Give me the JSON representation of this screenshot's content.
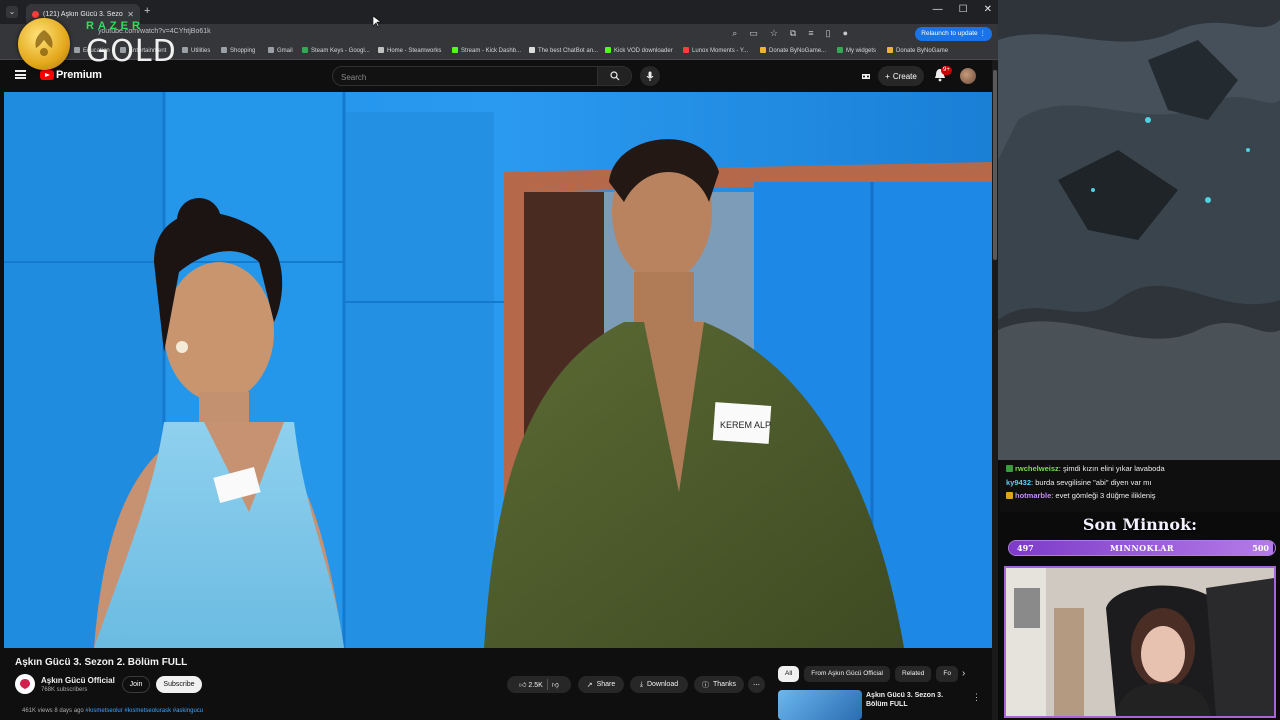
{
  "browser": {
    "tab_title": "(121) Aşkın Gücü 3. Sezon",
    "url": "youtube.com/watch?v=4CYhtjBo61k",
    "relaunch_label": "Relaunch to update",
    "bookmarks": [
      {
        "label": "Education",
        "color": "#9aa0a6"
      },
      {
        "label": "Entertainment",
        "color": "#9aa0a6"
      },
      {
        "label": "Utilities",
        "color": "#9aa0a6"
      },
      {
        "label": "Shopping",
        "color": "#9aa0a6"
      },
      {
        "label": "Gmail",
        "color": "#9aa0a6"
      },
      {
        "label": "Steam Keys - Googl...",
        "color": "#34a853"
      },
      {
        "label": "Home - Steamworks",
        "color": "#c0c0c0"
      },
      {
        "label": "Stream - Kick Dashb...",
        "color": "#53fc18"
      },
      {
        "label": "The best ChatBot an...",
        "color": "#dddddd"
      },
      {
        "label": "Kick VOD downloader",
        "color": "#53fc18"
      },
      {
        "label": "Lunox Moments - Y...",
        "color": "#ff3b3b"
      },
      {
        "label": "Donate ByNoGame...",
        "color": "#f0b33a"
      },
      {
        "label": "My widgets",
        "color": "#34a853"
      },
      {
        "label": "Donate ByNoGame",
        "color": "#f0b33a"
      }
    ]
  },
  "overlay": {
    "razer_word": "RAZER",
    "gold_word": "GOLD"
  },
  "youtube": {
    "brand": "Premium",
    "search_placeholder": "Search",
    "create_label": "Create",
    "notif_count": "9+",
    "video_title": "Aşkın Gücü 3. Sezon 2. Bölüm FULL",
    "name_tag": "KEREM ALP",
    "channel_name": "Aşkın Gücü Official",
    "subscribers": "768K subscribers",
    "join_label": "Join",
    "subscribe_label": "Subscribe",
    "likes": "2.5K",
    "share_label": "Share",
    "download_label": "Download",
    "thanks_label": "Thanks",
    "views_line": "461K views  8 days ago",
    "tags_line": "#kısmetseolur #kısmetseolurask #askingucu",
    "chips": [
      "All",
      "From Aşkın Gücü Official",
      "Related",
      "Fo"
    ],
    "rec_title": "Aşkın Gücü 3. Sezon 3. Bölüm FULL"
  },
  "stream": {
    "chat": [
      {
        "user": "rwchelweisz",
        "color": "#7ed957",
        "icon": "#3a9c3a",
        "msg": ": şimdi kızın elini yıkar lavaboda"
      },
      {
        "user": "ky9432",
        "color": "#5ad1e6",
        "icon": "",
        "msg": ": burda sevgilisine \"abi\" diyen var mı"
      },
      {
        "user": "hotmarble",
        "color": "#c58df0",
        "icon": "#e0a020",
        "msg": ": evet gömleği 3 düğme ilikleniş"
      }
    ],
    "goal_title": "Son Minnok:",
    "goal_current": "497",
    "goal_label": "MINNOKLAR",
    "goal_target": "500",
    "goal_fraction": 0.994
  },
  "colors": {
    "yt_red": "#ff0000",
    "accent_purple": "#a865d8",
    "razer_green": "#2ee05a",
    "link_blue": "#3ea6ff"
  }
}
